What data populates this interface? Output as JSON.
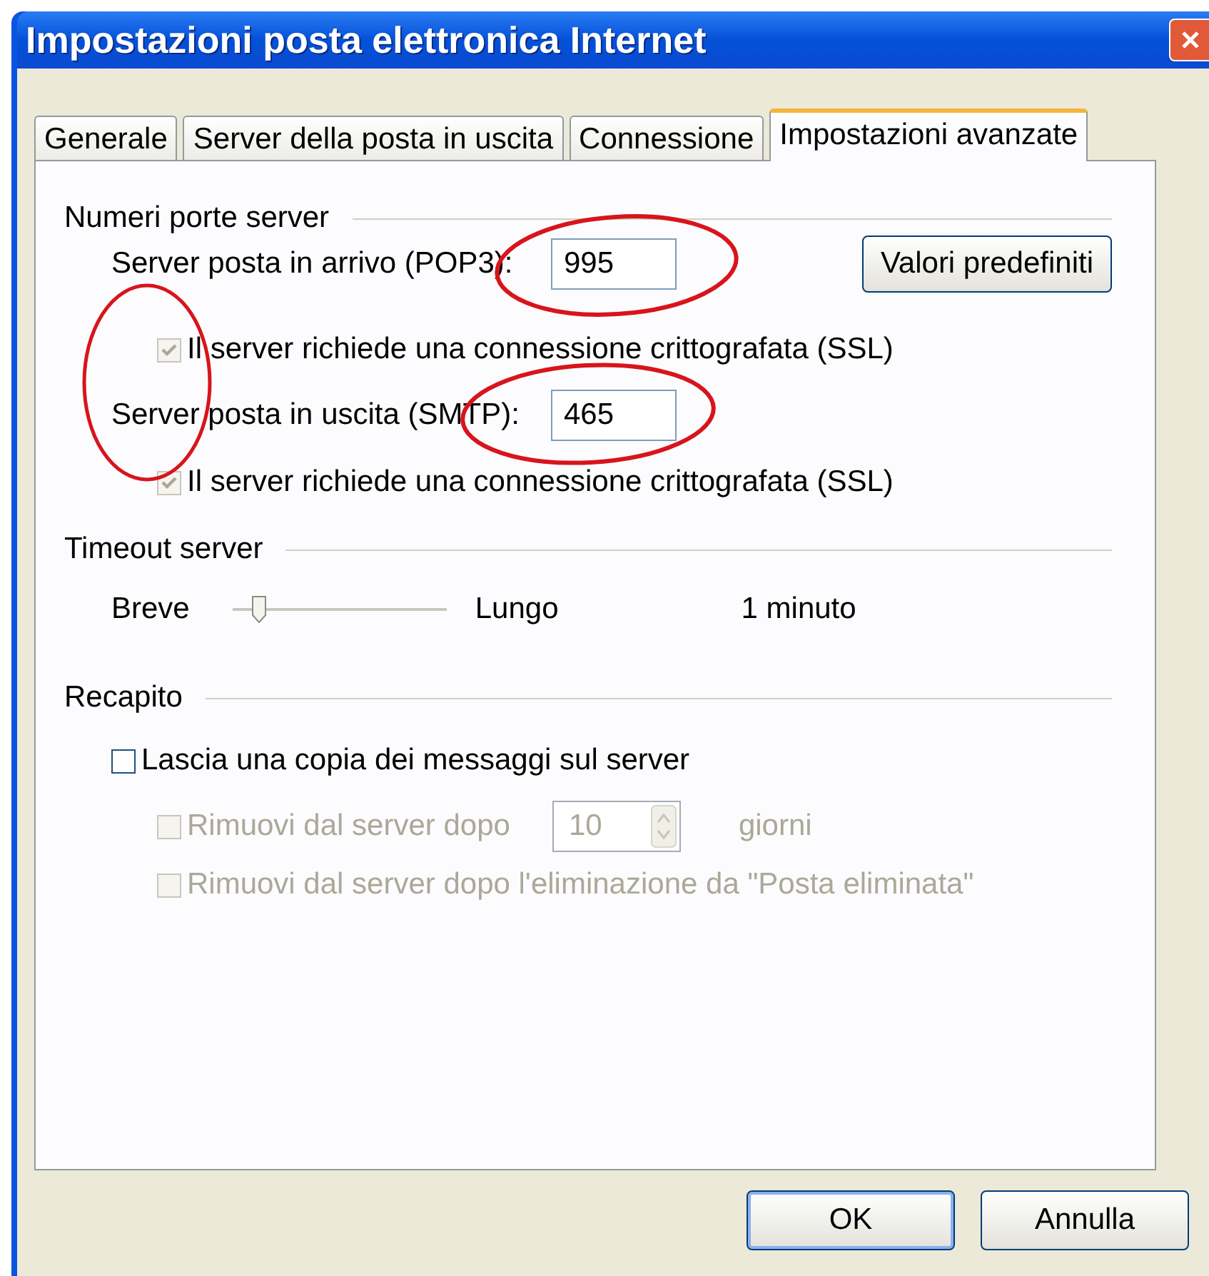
{
  "window": {
    "title": "Impostazioni posta elettronica Internet"
  },
  "tabs": [
    {
      "label": "Generale",
      "selected": false
    },
    {
      "label": "Server della posta in uscita",
      "selected": false
    },
    {
      "label": "Connessione",
      "selected": false
    },
    {
      "label": "Impostazioni avanzate",
      "selected": true
    }
  ],
  "ports": {
    "heading": "Numeri porte server",
    "defaults_button": "Valori predefiniti",
    "servers": [
      {
        "label": "Server posta in arrivo (POP3):",
        "value": "995",
        "ssl": {
          "label": "Il server richiede una connessione crittografata (SSL)",
          "checked": true,
          "disabled": true
        }
      },
      {
        "label": "Server posta in uscita (SMTP):",
        "value": "465",
        "ssl": {
          "label": "Il server richiede una connessione crittografata (SSL)",
          "checked": true,
          "disabled": true
        }
      }
    ]
  },
  "timeout": {
    "heading": "Timeout server",
    "min_label": "Breve",
    "max_label": "Lungo",
    "level": 0.12,
    "reading": "1 minuto"
  },
  "delivery": {
    "heading": "Recapito",
    "options": [
      {
        "kind": "checkbox",
        "label": "Lascia una copia dei messaggi sul server",
        "checked": false,
        "disabled": false
      },
      {
        "kind": "spin",
        "label": "Rimuovi dal server dopo",
        "value": "10",
        "unit": "giorni",
        "checked": false,
        "disabled": true
      },
      {
        "kind": "checkbox",
        "label": "Rimuovi dal server dopo l'eliminazione da \"Posta eliminata\"",
        "checked": false,
        "disabled": true
      }
    ]
  },
  "buttons": [
    {
      "label": "OK",
      "default": true
    },
    {
      "label": "Annulla",
      "default": false
    }
  ]
}
